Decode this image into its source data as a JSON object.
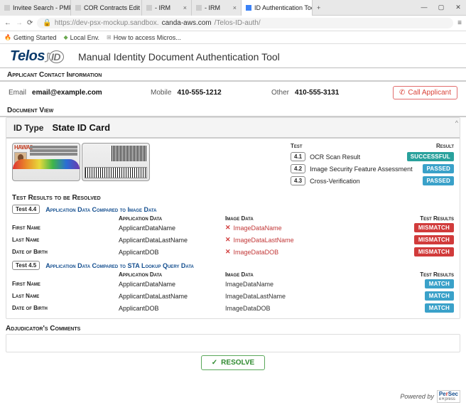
{
  "browser": {
    "tabs": [
      {
        "label": "Invitee Search - PMPortal"
      },
      {
        "label": "COR Contracts Edit - CorPortal"
      },
      {
        "label": "- IRM"
      },
      {
        "label": "- IRM"
      },
      {
        "label": "ID Authentication Tool",
        "active": true
      }
    ],
    "url_prefix": "https://dev-psx-mockup.sandbox.",
    "url_domain": "canda-aws.com",
    "url_path": "/Telos-ID-auth/",
    "bookmarks": [
      "Getting Started",
      "Local Env.",
      "How to access Micros..."
    ]
  },
  "logo": {
    "brand": "Telos",
    "suffix": "ID"
  },
  "app_title": "Manual Identity Document Authentication Tool",
  "sections": {
    "contact_label": "Applicant Contact Information",
    "docview_label": "Document View",
    "results_resolve_label": "Test Results to be Resolved",
    "adjudicator_label": "Adjudicator's Comments"
  },
  "contact": {
    "email_label": "Email",
    "email": "email@example.com",
    "mobile_label": "Mobile",
    "mobile": "410-555-1212",
    "other_label": "Other",
    "other": "410-555-3131",
    "call_btn": "Call Applicant"
  },
  "id": {
    "type_label": "ID Type",
    "type_value": "State ID Card",
    "front_state": "HAWAII"
  },
  "tests_header": {
    "left": "Test",
    "right": "Result"
  },
  "tests": [
    {
      "num": "4.1",
      "name": "OCR Scan Result",
      "badge": "Successful",
      "cls": "success"
    },
    {
      "num": "4.2",
      "name": "Image Security Feature Assessment",
      "badge": "Passed",
      "cls": "pass"
    },
    {
      "num": "4.3",
      "name": "Cross-Verification",
      "badge": "Passed",
      "cls": "pass"
    }
  ],
  "col_headers": {
    "app": "Application Data",
    "img": "Image Data",
    "res": "Test Results"
  },
  "subtests": [
    {
      "num": "Test 4.4",
      "desc": "Application Data Compared to Image Data",
      "rows": [
        {
          "field": "First Name",
          "app": "ApplicantDataName",
          "img": "ImageDataName",
          "mismatch": true
        },
        {
          "field": "Last Name",
          "app": "ApplicantDataLastName",
          "img": "ImageDataLastName",
          "mismatch": true
        },
        {
          "field": "Date of Birth",
          "app": "ApplicantDOB",
          "img": "ImageDataDOB",
          "mismatch": true
        }
      ]
    },
    {
      "num": "Test 4.5",
      "desc": "Application Data Compared to STA Lookup Query Data",
      "rows": [
        {
          "field": "First Name",
          "app": "ApplicantDataName",
          "img": "ImageDataName",
          "mismatch": false
        },
        {
          "field": "Last Name",
          "app": "ApplicantDataLastName",
          "img": "ImageDataLastName",
          "mismatch": false
        },
        {
          "field": "Date of Birth",
          "app": "ApplicantDOB",
          "img": "ImageDataDOB",
          "mismatch": false
        }
      ]
    }
  ],
  "badges": {
    "mismatch": "Mismatch",
    "match": "Match"
  },
  "resolve_btn": "RESOLVE",
  "powered_by": "Powered by"
}
